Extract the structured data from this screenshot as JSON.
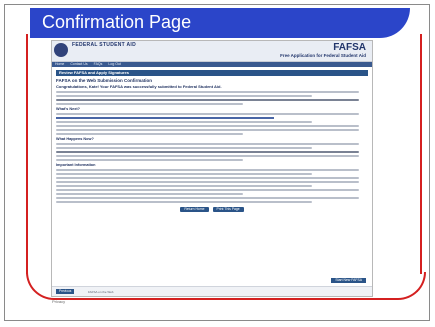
{
  "slide": {
    "title": "Confirmation Page"
  },
  "screenshot": {
    "agency": "FEDERAL STUDENT AID",
    "brand": "FAFSA",
    "brand_subtitle": "Free Application for Federal Student Aid",
    "nav": [
      "Home",
      "Contact Us",
      "FAQs",
      "Log Out"
    ],
    "section_header": "Review FAFSA and Apply Signatures",
    "confirmation_heading": "FAFSA on the Web Submission Confirmation",
    "congratulations": "Congratulations, Kate! Your FAFSA was successfully submitted to Federal Student Aid.",
    "subheads": [
      "What's Next?",
      "What Happens Now?",
      "Important Information"
    ],
    "buttons": [
      "Return Home",
      "Print This Page"
    ],
    "right_button": "Start New FAFSA",
    "footer_button": "Previous",
    "footer_info": "FAFSA on the Web",
    "privacy": "Privacy"
  },
  "colors": {
    "title_bar": "#2b45c9",
    "accent_line": "#d42020",
    "page_header": "#2a5488"
  }
}
